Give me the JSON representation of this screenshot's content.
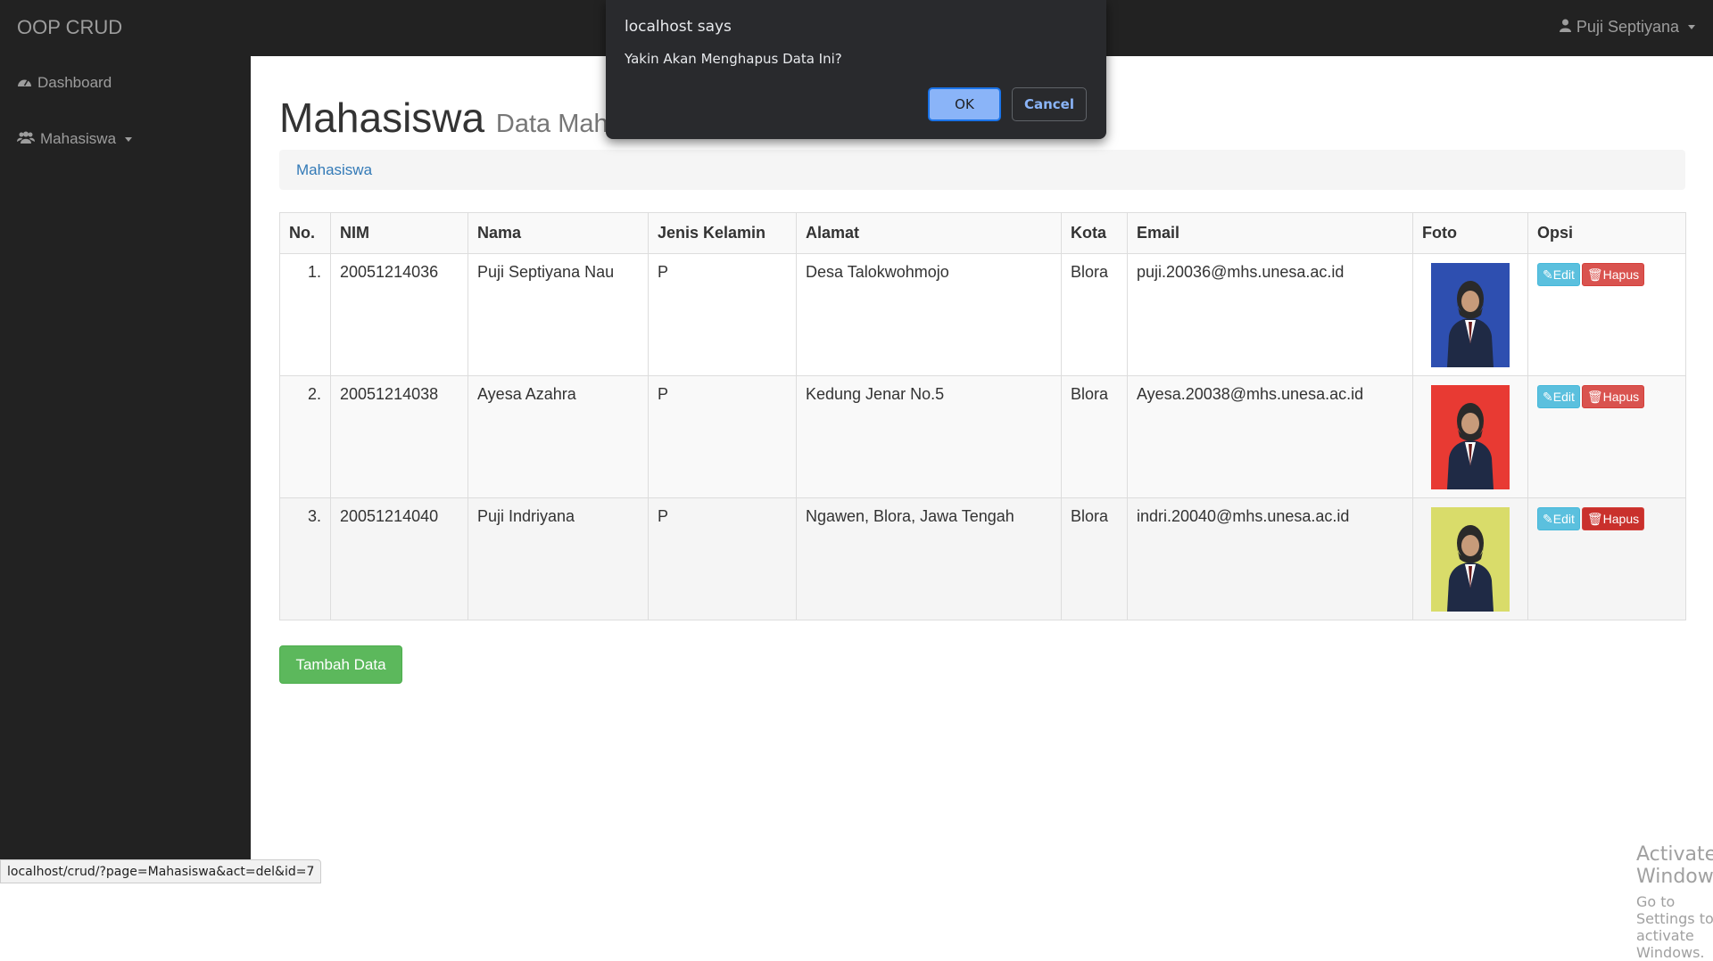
{
  "app": {
    "brand": "OOP CRUD",
    "user_name": "Puji Septiyana"
  },
  "sidebar": {
    "items": [
      {
        "label": "Dashboard",
        "icon": "dashboard-icon"
      },
      {
        "label": "Mahasiswa",
        "icon": "users-icon",
        "dropdown": true
      }
    ]
  },
  "page": {
    "title": "Mahasiswa",
    "subtitle": "Data Mahasiswa"
  },
  "breadcrumb": {
    "item": "Mahasiswa"
  },
  "table": {
    "headers": [
      "No.",
      "NIM",
      "Nama",
      "Jenis Kelamin",
      "Alamat",
      "Kota",
      "Email",
      "Foto",
      "Opsi"
    ],
    "rows": [
      {
        "no": "1.",
        "nim": "20051214036",
        "nama": "Puji Septiyana Nau",
        "jk": "P",
        "alamat": "Desa Talokwohmojo",
        "kota": "Blora",
        "email": "puji.20036@mhs.unesa.ac.id",
        "photo_bg": "#2e4fb0"
      },
      {
        "no": "2.",
        "nim": "20051214038",
        "nama": "Ayesa Azahra",
        "jk": "P",
        "alamat": "Kedung Jenar No.5",
        "kota": "Blora",
        "email": "Ayesa.20038@mhs.unesa.ac.id",
        "photo_bg": "#e83a33"
      },
      {
        "no": "3.",
        "nim": "20051214040",
        "nama": "Puji Indriyana",
        "jk": "P",
        "alamat": "Ngawen, Blora, Jawa Tengah",
        "kota": "Blora",
        "email": "indri.20040@mhs.unesa.ac.id",
        "photo_bg": "#d9dc6a"
      }
    ],
    "edit_label": "Edit",
    "delete_label": "Hapus"
  },
  "add_button": "Tambah Data",
  "dialog": {
    "title": "localhost says",
    "message": "Yakin Akan Menghapus Data Ini?",
    "ok": "OK",
    "cancel": "Cancel"
  },
  "status_url": "localhost/crud/?page=Mahasiswa&act=del&id=7",
  "watermark": {
    "line1": "Activate Windows",
    "line2": "Go to Settings to activate Windows."
  }
}
